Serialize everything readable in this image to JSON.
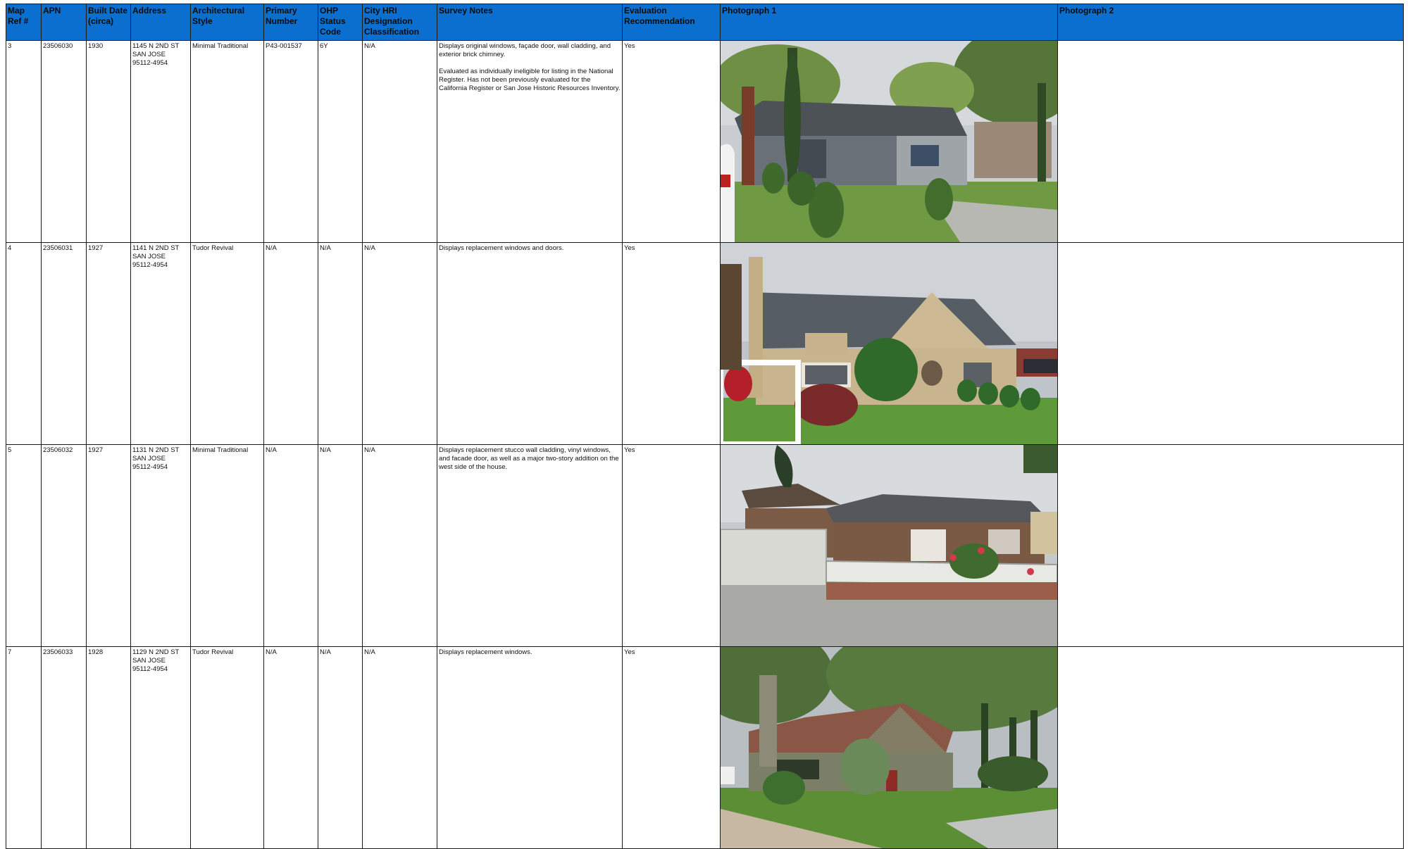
{
  "headers": {
    "map_ref": "Map Ref #",
    "apn": "APN",
    "built_date": "Built Date (circa)",
    "address": "Address",
    "style": "Architectural Style",
    "primary": "Primary Number",
    "ohp": "OHP Status Code",
    "hri": "City HRI Designation Classification",
    "notes": "Survey Notes",
    "evaluation": "Evaluation Recommendation",
    "photo1": "Photograph 1",
    "photo2": "Photograph 2"
  },
  "rows": [
    {
      "map_ref": "3",
      "apn": "23506030",
      "built": "1930",
      "address": [
        "1145 N 2ND ST",
        "SAN JOSE",
        "95112-4954"
      ],
      "style": "Minimal Traditional",
      "primary": "P43-001537",
      "ohp": "6Y",
      "hri": "N/A",
      "notes": [
        "Displays original windows, façade door, wall cladding, and exterior brick chimney.",
        "Evaluated as individually ineligible for listing in the National Register. Has not been previously evaluated for the California Register or San Jose Historic Resources Inventory."
      ],
      "evaluation": "Yes"
    },
    {
      "map_ref": "4",
      "apn": "23506031",
      "built": "1927",
      "address": [
        "1141 N 2ND ST",
        "SAN JOSE",
        "95112-4954"
      ],
      "style": "Tudor Revival",
      "primary": "N/A",
      "ohp": "N/A",
      "hri": "N/A",
      "notes": [
        "Displays replacement windows and doors."
      ],
      "evaluation": "Yes"
    },
    {
      "map_ref": "5",
      "apn": "23506032",
      "built": "1927",
      "address": [
        "1131 N 2ND ST",
        "SAN JOSE",
        "95112-4954"
      ],
      "style": "Minimal Traditional",
      "primary": "N/A",
      "ohp": "N/A",
      "hri": "N/A",
      "notes": [
        "Displays replacement stucco wall cladding, vinyl windows, and facade door, as well as a major two-story addition on the west side of the house."
      ],
      "evaluation": "Yes"
    },
    {
      "map_ref": "7",
      "apn": "23506033",
      "built": "1928",
      "address": [
        "1129 N 2ND ST",
        "SAN JOSE",
        "95112-4954"
      ],
      "style": "Tudor Revival",
      "primary": "N/A",
      "ohp": "N/A",
      "hri": "N/A",
      "notes": [
        "Displays replacement windows."
      ],
      "evaluation": "Yes"
    }
  ],
  "colors": {
    "header_bg": "#0a6fcf",
    "border": "#1a1a1a"
  }
}
